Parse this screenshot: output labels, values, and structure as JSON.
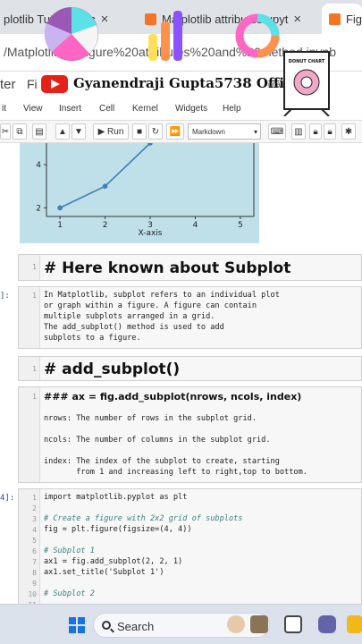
{
  "browser": {
    "tabs": [
      {
        "label": "plotlib Tuto",
        "suffix": "uc",
        "active": false
      },
      {
        "label": "Matplotlib attributes",
        "suffix": "upyt",
        "active": false
      },
      {
        "label": "Fig",
        "active": true
      }
    ],
    "close_glyph": "×",
    "address": "/Matplotlib... /Figure%20attributes%20and%20method.ipynb"
  },
  "jupyter": {
    "prev_fragment": "ter",
    "file_fragment": "Fi",
    "channel_name": "Gyanendraji Gupta5738 Official",
    "right_fragment": "ur ad        d changes",
    "menu": [
      "it",
      "View",
      "Insert",
      "Cell",
      "Kernel",
      "Widgets",
      "Help"
    ],
    "run_label": "Run",
    "cell_type": "Markdown"
  },
  "overlay": {
    "donut_chart_label": "DONUT CHART"
  },
  "plot": {
    "xlabel": "X-axis",
    "xticks": [
      "1",
      "2",
      "3",
      "4",
      "5"
    ],
    "yticks": [
      "2",
      "4"
    ]
  },
  "chart_data": {
    "type": "line",
    "title": "",
    "xlabel": "X-axis",
    "ylabel": "",
    "x": [
      1,
      2,
      3
    ],
    "values": [
      2,
      3,
      5
    ],
    "xlim": [
      0.7,
      5.3
    ],
    "ylim": [
      1.6,
      5.0
    ],
    "color": "#3f7fb5"
  },
  "cells": {
    "h_subplot": {
      "line": "1",
      "text": "# Here known about Subplot"
    },
    "intro": {
      "prompt": "]:",
      "line": "1",
      "lines": [
        "In Matplotlib, subplot refers to an individual plot",
        "or graph within a figure. A figure can contain",
        "multiple subplots arranged in a grid.",
        "The add_subplot() method is used to add",
        "subplots to a figure."
      ]
    },
    "h_add": {
      "line": "1",
      "text": "# add_subplot()"
    },
    "params": {
      "line": "1",
      "heading": "### ax = fig.add_subplot(nrows, ncols, index)",
      "nrows": "nrows: The number of rows in the subplot grid.",
      "ncols": "ncols: The number of columns in the subplot grid.",
      "index1": "index: The index of the subplot to create, starting",
      "index2": "       from 1 and increasing left to right,top to bottom."
    },
    "code": {
      "prompt": "4]:",
      "line_numbers": [
        "1",
        "2",
        "3",
        "4",
        "5",
        "6",
        "7",
        "8",
        "9",
        "10",
        "11"
      ],
      "import": "import matplotlib.pyplot as plt",
      "comment1": "# Create a figure with 2x2 grid of subplots",
      "fig": "fig = plt.figure(figsize=(4, 4))",
      "comment2": "# Subplot 1",
      "ax1": "ax1 = fig.add_subplot(2, 2, 1)",
      "title1": "ax1.set_title('Subplot 1')",
      "comment3": "# Subplot 2"
    }
  },
  "taskbar": {
    "search_label": "Search"
  },
  "colors": {
    "plot_bg": "#bfe0e8",
    "line": "#3f7fb5",
    "taskbar": "#dbe2ec",
    "youtube": "#e62117"
  }
}
